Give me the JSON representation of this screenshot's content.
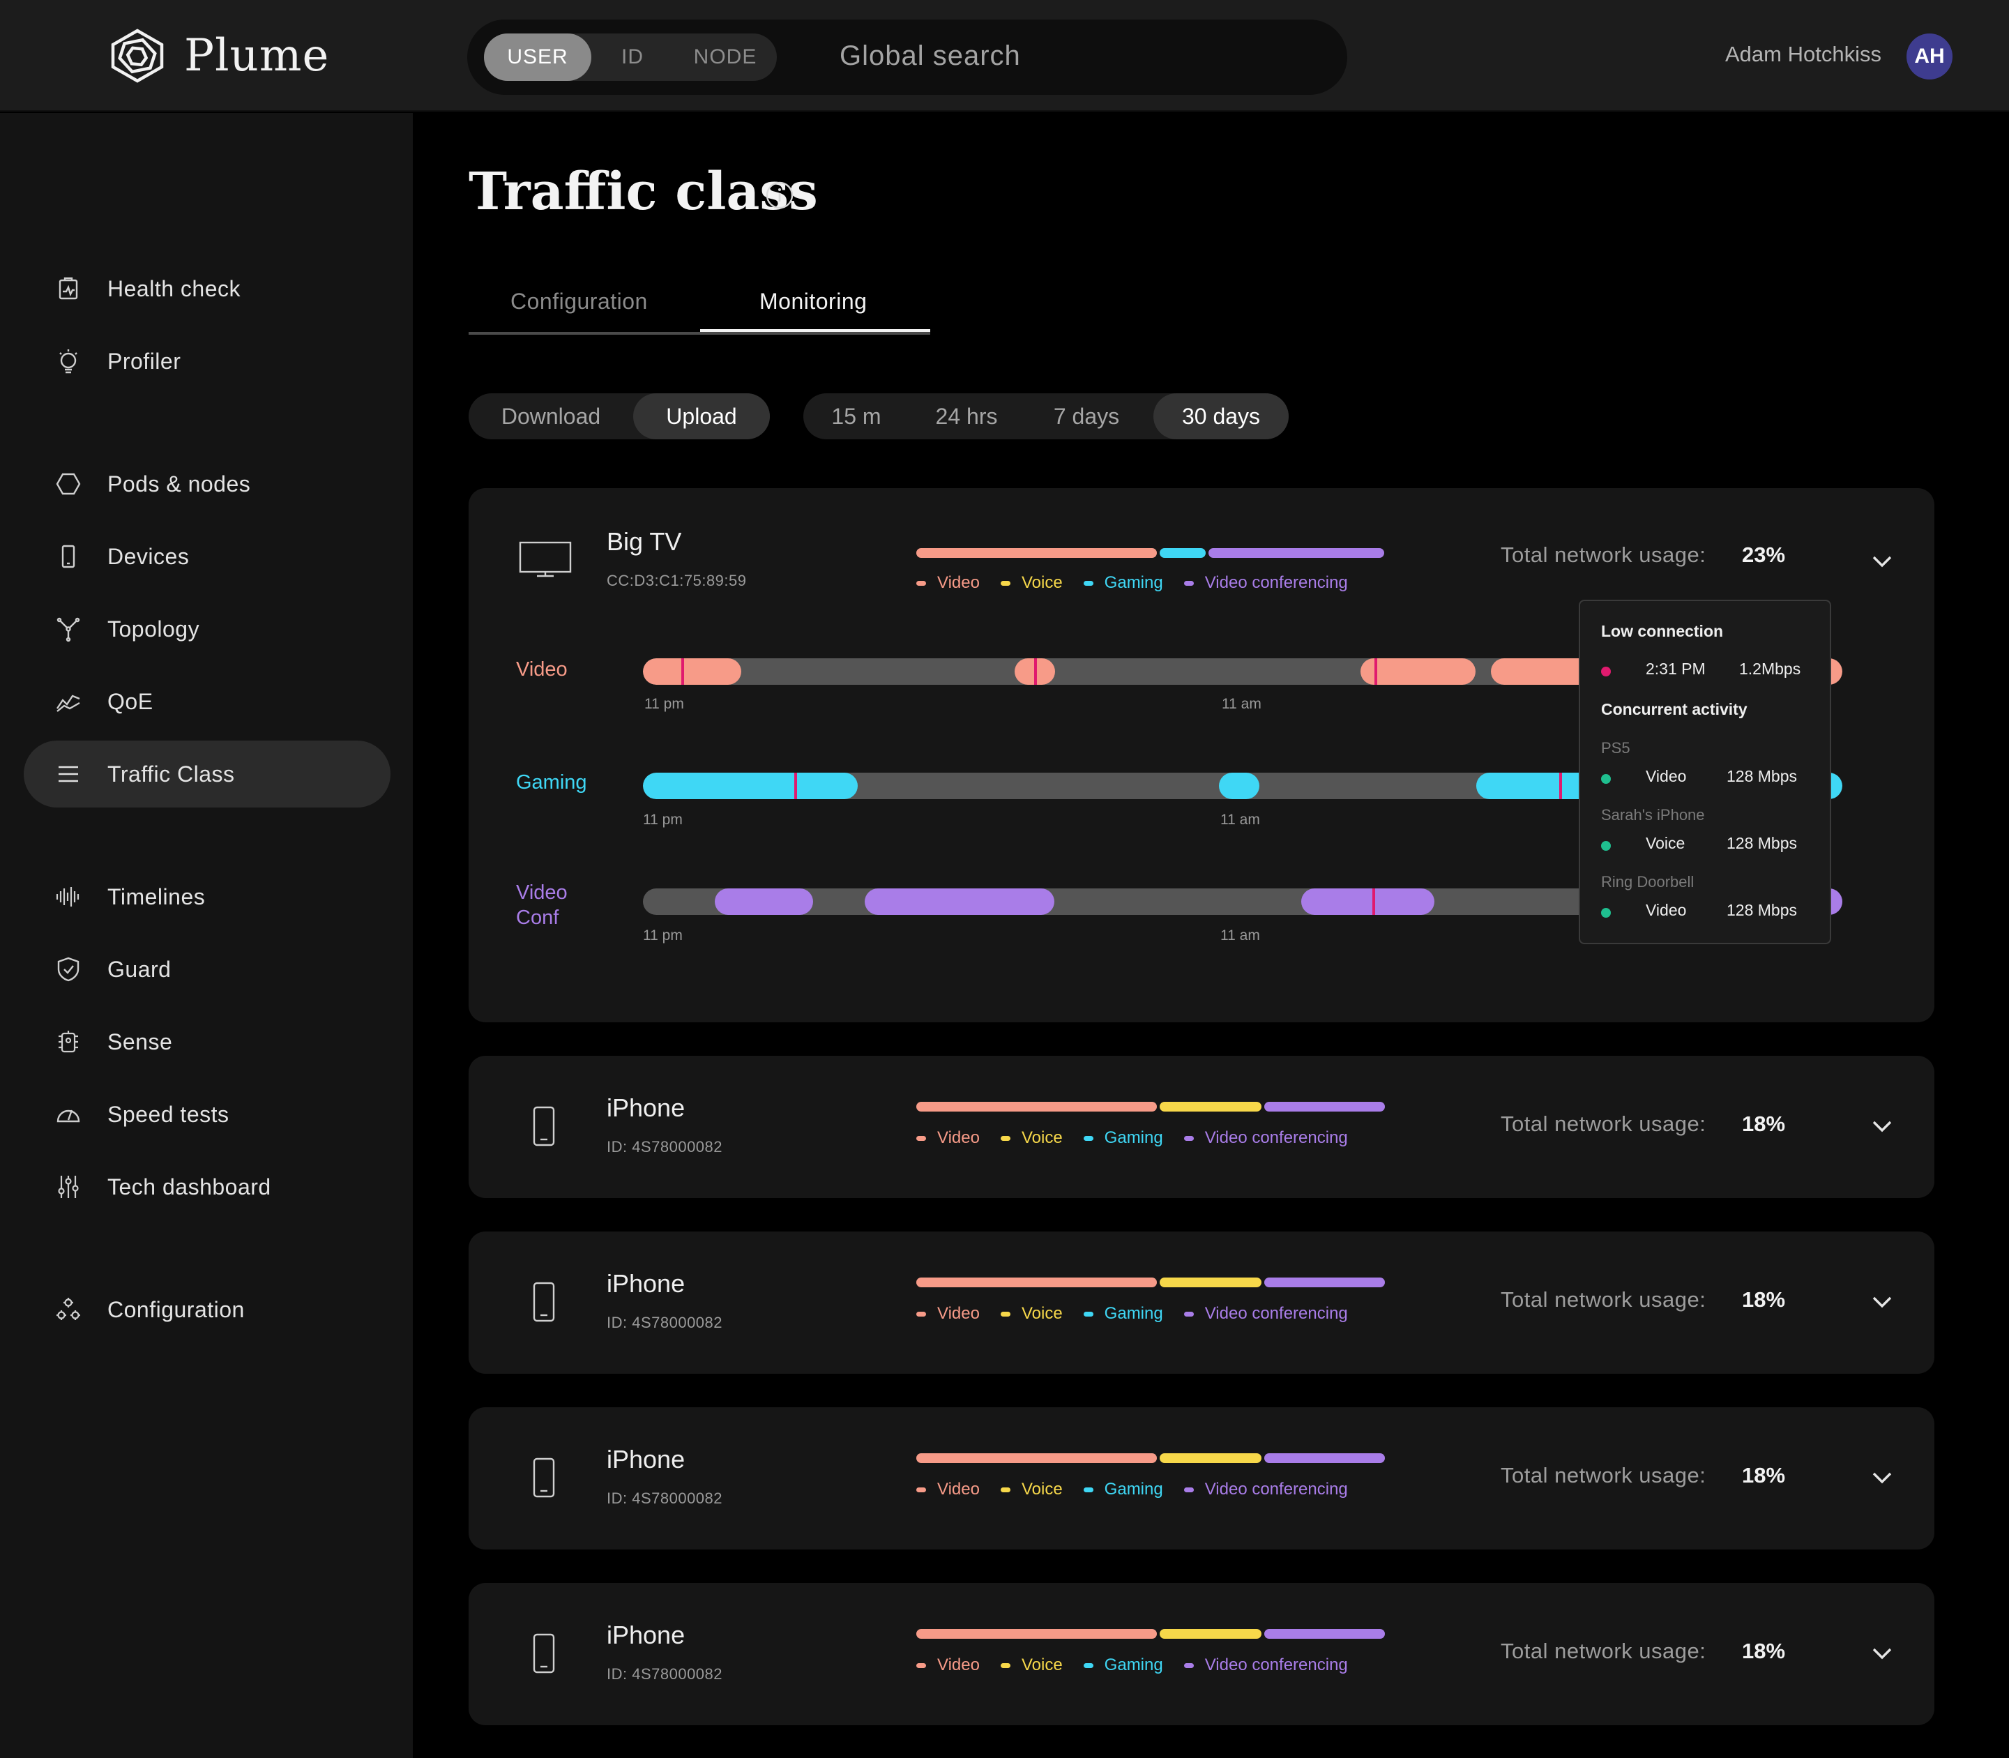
{
  "app": {
    "logo_text": "Plume",
    "search": {
      "segments": [
        "USER",
        "ID",
        "NODE"
      ],
      "selected_segment": "USER",
      "placeholder": "Global search"
    },
    "user": {
      "name": "Adam Hotchkiss",
      "initials": "AH"
    }
  },
  "colors": {
    "video": "#f79b88",
    "voice": "#f7d84a",
    "gaming": "#3fd7f5",
    "video_conferencing": "#a97de8",
    "marker": "#e01a6e",
    "ok_dot": "#1fbf8f"
  },
  "sidebar": {
    "active": "Traffic Class",
    "items": [
      {
        "label": "Health check",
        "icon": "health-check-icon"
      },
      {
        "label": "Profiler",
        "icon": "lightbulb-icon"
      },
      {
        "label": "Pods & nodes",
        "icon": "hexagon-icon"
      },
      {
        "label": "Devices",
        "icon": "phone-icon"
      },
      {
        "label": "Topology",
        "icon": "topology-icon"
      },
      {
        "label": "QoE",
        "icon": "qoe-chart-icon"
      },
      {
        "label": "Traffic Class",
        "icon": "list-icon"
      },
      {
        "label": "Timelines",
        "icon": "waveform-icon"
      },
      {
        "label": "Guard",
        "icon": "shield-icon"
      },
      {
        "label": "Sense",
        "icon": "sense-icon"
      },
      {
        "label": "Speed tests",
        "icon": "speedometer-icon"
      },
      {
        "label": "Tech dashboard",
        "icon": "sliders-icon"
      },
      {
        "label": "Configuration",
        "icon": "gears-icon"
      }
    ]
  },
  "page": {
    "title": "Traffic class",
    "tabs": [
      "Configuration",
      "Monitoring"
    ],
    "active_tab": "Monitoring",
    "direction_filter": {
      "options": [
        "Download",
        "Upload"
      ],
      "selected": "Upload"
    },
    "time_filter": {
      "options": [
        "15 m",
        "24 hrs",
        "7 days",
        "30 days"
      ],
      "selected": "30 days"
    }
  },
  "legend_labels": [
    "Video",
    "Voice",
    "Gaming",
    "Video conferencing"
  ],
  "usage_label": "Total network usage:",
  "devices": [
    {
      "name": "Big TV",
      "id": "CC:D3:C1:75:89:59",
      "icon": "tv-icon",
      "usage": "23%",
      "expanded": true,
      "mix": {
        "video": 0.52,
        "voice": 0.0,
        "gaming": 0.1,
        "video_conferencing": 0.38
      }
    },
    {
      "name": "iPhone",
      "id": "ID: 4S78000082",
      "icon": "phone-icon",
      "usage": "18%",
      "expanded": false,
      "mix": {
        "video": 0.52,
        "voice": 0.22,
        "gaming": 0.0,
        "video_conferencing": 0.26
      }
    },
    {
      "name": "iPhone",
      "id": "ID: 4S78000082",
      "icon": "phone-icon",
      "usage": "18%",
      "expanded": false,
      "mix": {
        "video": 0.52,
        "voice": 0.22,
        "gaming": 0.0,
        "video_conferencing": 0.26
      }
    },
    {
      "name": "iPhone",
      "id": "ID: 4S78000082",
      "icon": "phone-icon",
      "usage": "18%",
      "expanded": false,
      "mix": {
        "video": 0.52,
        "voice": 0.22,
        "gaming": 0.0,
        "video_conferencing": 0.26
      }
    },
    {
      "name": "iPhone",
      "id": "ID: 4S78000082",
      "icon": "phone-icon",
      "usage": "18%",
      "expanded": false,
      "mix": {
        "video": 0.52,
        "voice": 0.22,
        "gaming": 0.0,
        "video_conferencing": 0.26
      }
    }
  ],
  "timelines": [
    {
      "label_lines": [
        "Video"
      ],
      "color_key": "video",
      "ticks": [
        "11 pm",
        "11 am"
      ],
      "active_spans": [
        [
          0.0,
          0.082
        ],
        [
          0.31,
          0.344
        ],
        [
          0.598,
          0.694
        ],
        [
          0.707,
          1.0
        ]
      ],
      "markers": [
        0.032,
        0.326,
        0.61
      ]
    },
    {
      "label_lines": [
        "Gaming"
      ],
      "color_key": "gaming",
      "ticks": [
        "11 pm",
        "11 am"
      ],
      "active_spans": [
        [
          0.0,
          0.179
        ],
        [
          0.48,
          0.514
        ],
        [
          0.695,
          1.0
        ]
      ],
      "markers": [
        0.126,
        0.764
      ]
    },
    {
      "label_lines": [
        "Video",
        "Conf"
      ],
      "color_key": "video_conferencing",
      "ticks": [
        "11 pm",
        "11 am"
      ],
      "active_spans": [
        [
          0.06,
          0.142
        ],
        [
          0.185,
          0.343
        ],
        [
          0.549,
          0.66
        ],
        [
          0.985,
          1.0
        ]
      ],
      "markers": [
        0.608
      ]
    }
  ],
  "tooltip": {
    "title": "Low connection",
    "event": {
      "time": "2:31 PM",
      "rate": "1.2Mbps"
    },
    "concurrent_title": "Concurrent activity",
    "rows": [
      {
        "device": "PS5",
        "type": "Video",
        "rate": "128 Mbps"
      },
      {
        "device": "Sarah's iPhone",
        "type": "Voice",
        "rate": "128 Mbps"
      },
      {
        "device": "Ring Doorbell",
        "type": "Video",
        "rate": "128 Mbps"
      }
    ]
  }
}
